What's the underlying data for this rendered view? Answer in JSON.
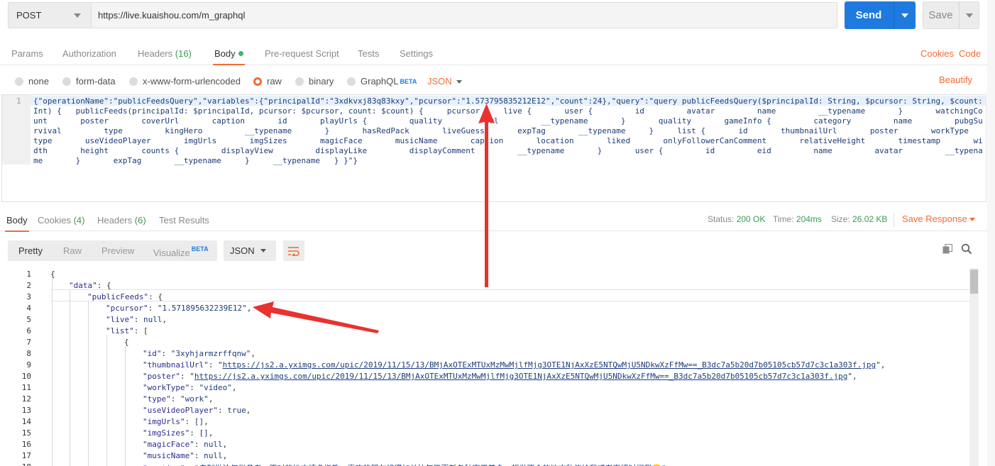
{
  "request": {
    "method": "POST",
    "url": "https://live.kuaishou.com/m_graphql",
    "send_label": "Send",
    "save_label": "Save"
  },
  "req_tabs": {
    "params": "Params",
    "authorization": "Authorization",
    "headers": "Headers",
    "headers_count": "(16)",
    "body": "Body",
    "prerequest": "Pre-request Script",
    "tests": "Tests",
    "settings": "Settings",
    "cookies": "Cookies",
    "code": "Code"
  },
  "body_types": {
    "none": "none",
    "form_data": "form-data",
    "urlencoded": "x-www-form-urlencoded",
    "raw": "raw",
    "binary": "binary",
    "graphql": "GraphQL",
    "beta": "BETA",
    "format": "JSON",
    "beautify": "Beautify"
  },
  "request_body": {
    "line_number": "1",
    "text": "{\"operationName\":\"publicFeedsQuery\",\"variables\":{\"principalId\":\"3xdkvxj83q83kxy\",\"pcursor\":\"1.573795835212E12\",\"count\":24},\"query\":\"query publicFeedsQuery($principalId: String, $pcursor: String, $count: Int) {   publicFeeds(principalId: $principalId, pcursor: $pcursor, count: $count) {     pcursor     live {       user {         id         avatar         name         __typename       }       watchingCount       poster       coverUrl       caption       id       playUrls {         quality         url         __typename       }       quality       gameInfo {         category         name         pubgSurvival         type         kingHero         __typename       }       hasRedPack       liveGuess       expTag       __typename     }     list {       id       thumbnailUrl       poster       workType       type       useVideoPlayer       imgUrls       imgSizes       magicFace       musicName       caption       location       liked       onlyFollowerCanComment       relativeHeight       timestamp       width       height       counts {         displayView         displayLike         displayComment         __typename       }       user {         id         eid         name         avatar         __typename       }       expTag       __typename     }     __typename   } }\"}"
  },
  "response_tabs": {
    "body": "Body",
    "cookies": "Cookies",
    "cookies_count": "(4)",
    "headers": "Headers",
    "headers_count": "(6)",
    "test_results": "Test Results"
  },
  "response_status": {
    "status_label": "Status:",
    "status_value": "200 OK",
    "time_label": "Time:",
    "time_value": "204ms",
    "size_label": "Size:",
    "size_value": "26.02 KB",
    "save_response": "Save Response"
  },
  "response_view": {
    "pretty": "Pretty",
    "raw": "Raw",
    "preview": "Preview",
    "visualize": "Visualize",
    "beta": "BETA",
    "format": "JSON"
  },
  "response_lines": [
    {
      "n": "1",
      "text": "{"
    },
    {
      "n": "2",
      "key": "\"data\"",
      "rest": ": {"
    },
    {
      "n": "3",
      "key": "\"publicFeeds\"",
      "rest": ": {"
    },
    {
      "n": "4",
      "key": "\"pcursor\"",
      "str": "\"1.571895632239E12\"",
      "tail": ","
    },
    {
      "n": "5",
      "key": "\"live\"",
      "kw": "null",
      "tail": ","
    },
    {
      "n": "6",
      "key": "\"list\"",
      "rest": ": ["
    },
    {
      "n": "7",
      "text": "{"
    },
    {
      "n": "8",
      "key": "\"id\"",
      "str": "\"3xyhjarmzrffqnw\"",
      "tail": ","
    },
    {
      "n": "9",
      "key": "\"thumbnailUrl\"",
      "url": "https://js2.a.yximgs.com/upic/2019/11/15/13/BMjAxOTExMTUxMzMwMjlfMjg3OTE1NjAxXzE5NTQwMjU5NDkwXzFfMw==_B3dc7a5b20d7b05105cb57d7c3c1a303f.jpg",
      "tail": "\","
    },
    {
      "n": "10",
      "key": "\"poster\"",
      "url": "https://js2.a.yximgs.com/upic/2019/11/15/13/BMjAxOTExMTUxMzMwMjlfMjg3OTE1NjAxXzE5NTQwMjU5NDkwXzFfMw==_B3dc7a5b20d7b05105cb57d7c3c1a303f.jpg",
      "tail": "\","
    },
    {
      "n": "11",
      "key": "\"workType\"",
      "str": "\"video\"",
      "tail": ","
    },
    {
      "n": "12",
      "key": "\"type\"",
      "str": "\"work\"",
      "tail": ","
    },
    {
      "n": "13",
      "key": "\"useVideoPlayer\"",
      "kw": "true",
      "tail": ","
    },
    {
      "n": "14",
      "key": "\"imgUrls\"",
      "kw": "[]",
      "tail": ","
    },
    {
      "n": "15",
      "key": "\"imgSizes\"",
      "kw": "[]",
      "tail": ","
    },
    {
      "n": "16",
      "key": "\"magicFace\"",
      "kw": "null",
      "tail": ","
    },
    {
      "n": "17",
      "key": "\"musicName\"",
      "kw": "null",
      "tail": ","
    },
    {
      "n": "18",
      "key": "\"caption\"",
      "str": "\"自制做法仅供参考，不对的地方请多指教，喜欢的朋友记得加关注每天更新各种家常美食，想做不会的地方私信给我或者直播时问我😊\"",
      "tail": ""
    }
  ],
  "colors": {
    "accent": "#f26b3a",
    "send_blue": "#1f7ae0",
    "count_green": "#3d9a55",
    "arrow_red": "#e8322f"
  }
}
